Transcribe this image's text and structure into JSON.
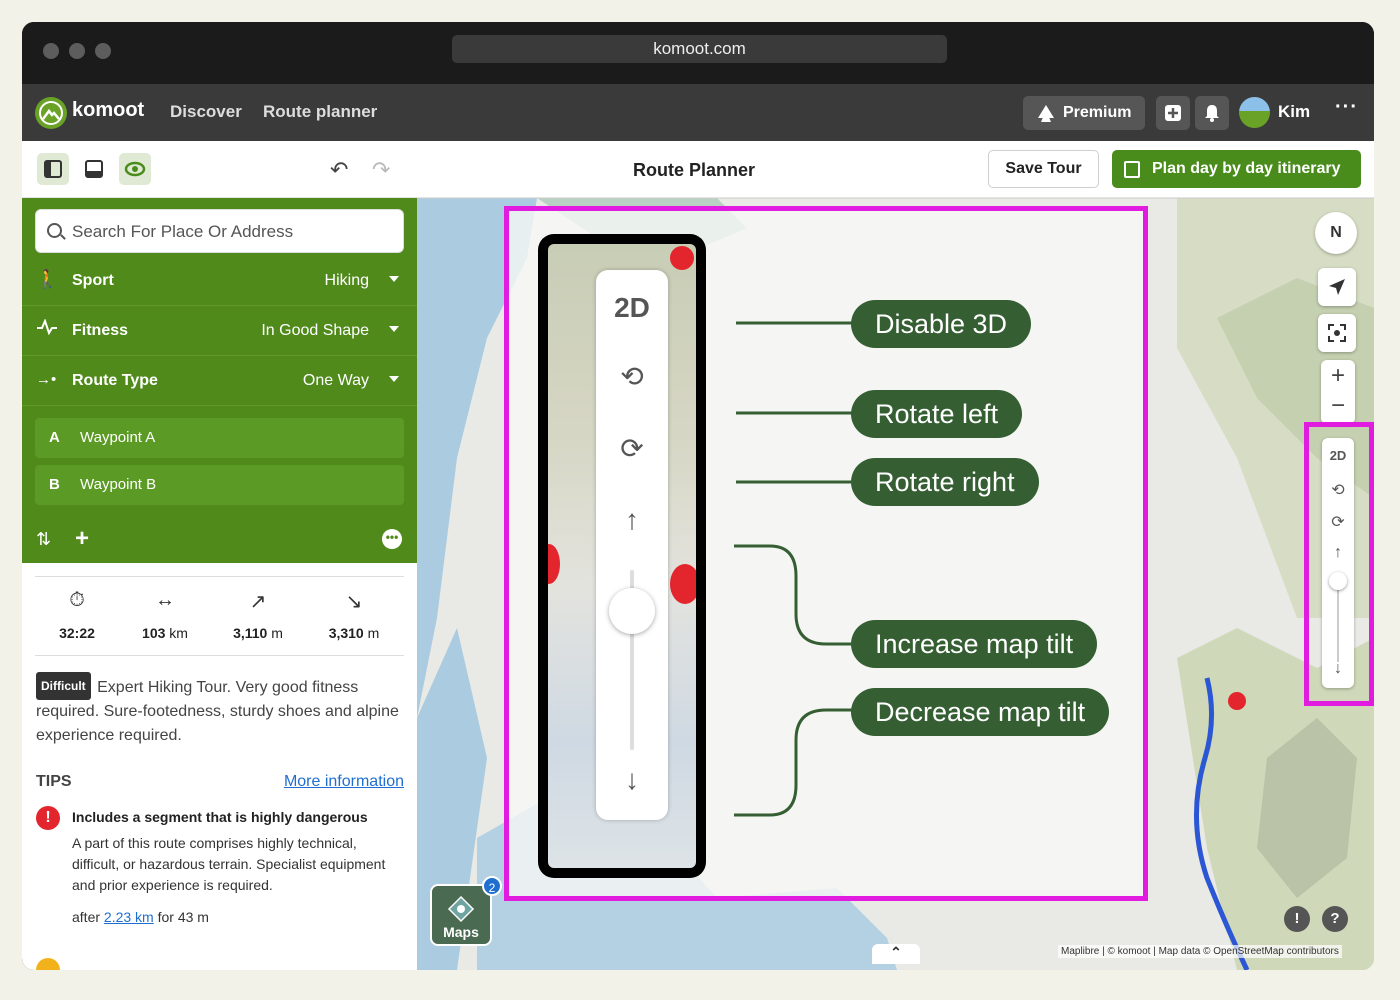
{
  "browser": {
    "url": "komoot.com"
  },
  "nav": {
    "brand": "komoot",
    "links": [
      "Discover",
      "Route planner"
    ],
    "premium": "Premium",
    "user": "Kim",
    "more": "···"
  },
  "toolbar": {
    "title": "Route Planner",
    "save": "Save Tour",
    "plan": "Plan day by day itinerary"
  },
  "sidebar": {
    "search_placeholder": "Search For Place Or Address",
    "settings": [
      {
        "label": "Sport",
        "value": "Hiking"
      },
      {
        "label": "Fitness",
        "value": "In Good Shape"
      },
      {
        "label": "Route Type",
        "value": "One Way"
      }
    ],
    "waypoints": [
      {
        "letter": "A",
        "name": "Waypoint A"
      },
      {
        "letter": "B",
        "name": "Waypoint B"
      }
    ],
    "stats": {
      "duration": "32:22",
      "distance": "103",
      "distance_unit": "km",
      "up": "3,110",
      "up_unit": "m",
      "down": "3,310",
      "down_unit": "m"
    },
    "difficulty_badge": "Difficult",
    "difficulty_text": "Expert Hiking Tour. Very good fitness required. Sure-footedness, sturdy shoes and alpine experience required.",
    "tips_label": "TIPS",
    "more_info": "More information",
    "tip": {
      "title": "Includes a segment that is highly dangerous",
      "body": "A part of this route comprises highly technical, difficult, or hazardous terrain. Specialist equipment and prior experience is required.",
      "after_prefix": "after",
      "after_link": "2.23 km",
      "after_suffix": "for 43 m"
    }
  },
  "zoom_panel": {
    "mode": "2D"
  },
  "callouts": [
    "Disable 3D",
    "Rotate left",
    "Rotate right",
    "Increase map tilt",
    "Decrease map tilt"
  ],
  "map": {
    "compass": "N",
    "small_mode": "2D",
    "maps_label": "Maps",
    "maps_badge": "2",
    "attribution": "Maplibre | © komoot | Map data © OpenStreetMap contributors"
  },
  "colors": {
    "accent": "#4f8a1b",
    "highlight": "#e11ce0",
    "callout": "#355e33"
  }
}
